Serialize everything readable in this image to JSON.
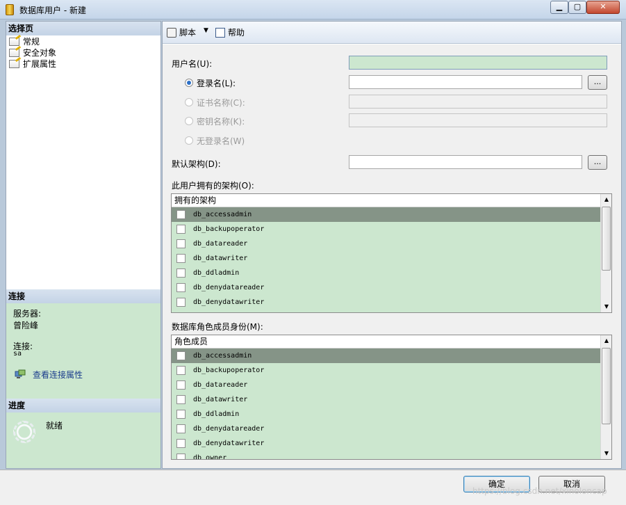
{
  "window": {
    "title": "数据库用户 - 新建",
    "controls": {
      "minimize": "▁",
      "maximize": "▢",
      "close": "✕"
    }
  },
  "left_panel": {
    "select_page_header": "选择页",
    "pages": [
      {
        "label": "常规",
        "icon": "page-icon"
      },
      {
        "label": "安全对象",
        "icon": "page-icon"
      },
      {
        "label": "扩展属性",
        "icon": "page-icon"
      }
    ],
    "connection": {
      "header": "连接",
      "server_label": "服务器:",
      "server_value": "曾险峰",
      "login_label": "连接:",
      "login_value": "sa",
      "view_props_link": "查看连接属性"
    },
    "progress": {
      "header": "进度",
      "status": "就绪"
    }
  },
  "toolbar": {
    "script_label": "脚本",
    "help_label": "帮助"
  },
  "form": {
    "username_label": "用户名(U):",
    "username_value": "",
    "radio_options": [
      {
        "label": "登录名(L):",
        "selected": true,
        "enabled": true
      },
      {
        "label": "证书名称(C):",
        "selected": false,
        "enabled": false
      },
      {
        "label": "密钥名称(K):",
        "selected": false,
        "enabled": false
      },
      {
        "label": "无登录名(W)",
        "selected": false,
        "enabled": false
      }
    ],
    "login_value": "",
    "browse_label": "...",
    "default_schema_label": "默认架构(D):",
    "default_schema_value": "",
    "owned_schemas_label": "此用户拥有的架构(O):",
    "owned_schemas_header": "拥有的架构",
    "owned_schemas": [
      "db_accessadmin",
      "db_backupoperator",
      "db_datareader",
      "db_datawriter",
      "db_ddladmin",
      "db_denydatareader",
      "db_denydatawriter"
    ],
    "role_membership_label": "数据库角色成员身份(M):",
    "role_membership_header": "角色成员",
    "role_members": [
      "db_accessadmin",
      "db_backupoperator",
      "db_datareader",
      "db_datawriter",
      "db_ddladmin",
      "db_denydatareader",
      "db_denydatawriter",
      "db_owner"
    ]
  },
  "footer": {
    "ok_label": "确定",
    "cancel_label": "取消",
    "watermark": "https://blog.csdn.net/xinoloncap"
  },
  "colors": {
    "highlight_green": "#cce7cf",
    "selected_row": "#859487",
    "header_blue": "#c4d3e6"
  }
}
